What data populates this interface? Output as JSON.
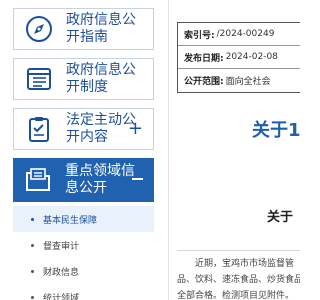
{
  "sidebar": {
    "items": [
      {
        "label": "政府信息公开指南",
        "icon": "compass-icon"
      },
      {
        "label": "政府信息公开制度",
        "icon": "document-list-icon"
      },
      {
        "label": "法定主动公开内容",
        "icon": "clipboard-icon",
        "expand": "+"
      },
      {
        "label": "重点领域信息公开",
        "icon": "folder-icon",
        "collapse": "−"
      }
    ],
    "sub_items": [
      "基本民生保障",
      "督查审计",
      "财政信息",
      "统计领域"
    ],
    "active_sub": 0
  },
  "meta": {
    "rows": [
      {
        "key": "索引号:",
        "value": "/2024-00249"
      },
      {
        "key": "发布日期:",
        "value": "2024-02-08"
      },
      {
        "key": "公开范围:",
        "value": "面向全社会"
      }
    ]
  },
  "article": {
    "title": "关于1",
    "subtitle": "关于",
    "body_lines": [
      "近期，宝鸡市市场监督管",
      "品、饮料、速冻食品、炒货食品",
      "全部合格。检测项目见附件。"
    ]
  },
  "colors": {
    "accent": "#2162b0",
    "nav_text": "#1f4f9c",
    "title": "#1f5fb0"
  }
}
